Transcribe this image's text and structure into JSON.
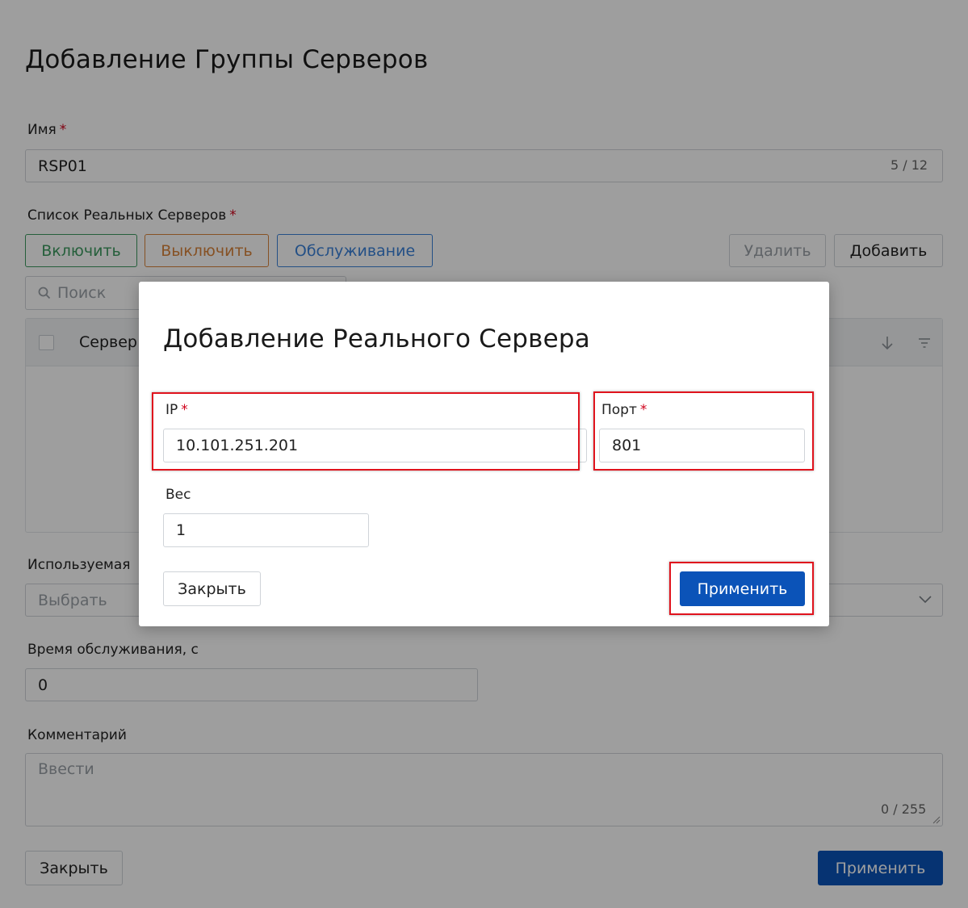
{
  "form": {
    "title": "Добавление Группы Серверов",
    "name": {
      "label": "Имя",
      "required_mark": "*",
      "value": "RSP01",
      "counter": "5 / 12"
    },
    "servers": {
      "label": "Список Реальных Серверов",
      "required_mark": "*",
      "buttons": {
        "enable": "Включить",
        "disable": "Выключить",
        "maintenance": "Обслуживание",
        "delete": "Удалить",
        "add": "Добавить"
      },
      "search_placeholder": "Поиск",
      "table": {
        "column_server": "Сервер"
      }
    },
    "used": {
      "label": "Используемая",
      "placeholder": "Выбрать"
    },
    "service_time": {
      "label": "Время обслуживания, с",
      "value": "0"
    },
    "comment": {
      "label": "Комментарий",
      "placeholder": "Ввести",
      "counter": "0 / 255"
    },
    "footer": {
      "close": "Закрыть",
      "apply": "Применить"
    }
  },
  "modal": {
    "title": "Добавление Реального Сервера",
    "ip": {
      "label": "IP",
      "required_mark": "*",
      "value": "10.101.251.201"
    },
    "port": {
      "label": "Порт",
      "required_mark": "*",
      "value": "801"
    },
    "weight": {
      "label": "Вес",
      "value": "1"
    },
    "close": "Закрыть",
    "apply": "Применить"
  },
  "colors": {
    "primary": "#0b53b8",
    "enable": "#3c9a5f",
    "disable": "#d9843b",
    "maintenance": "#3b82d9",
    "highlight": "#e0131d",
    "required": "#d0021b"
  }
}
